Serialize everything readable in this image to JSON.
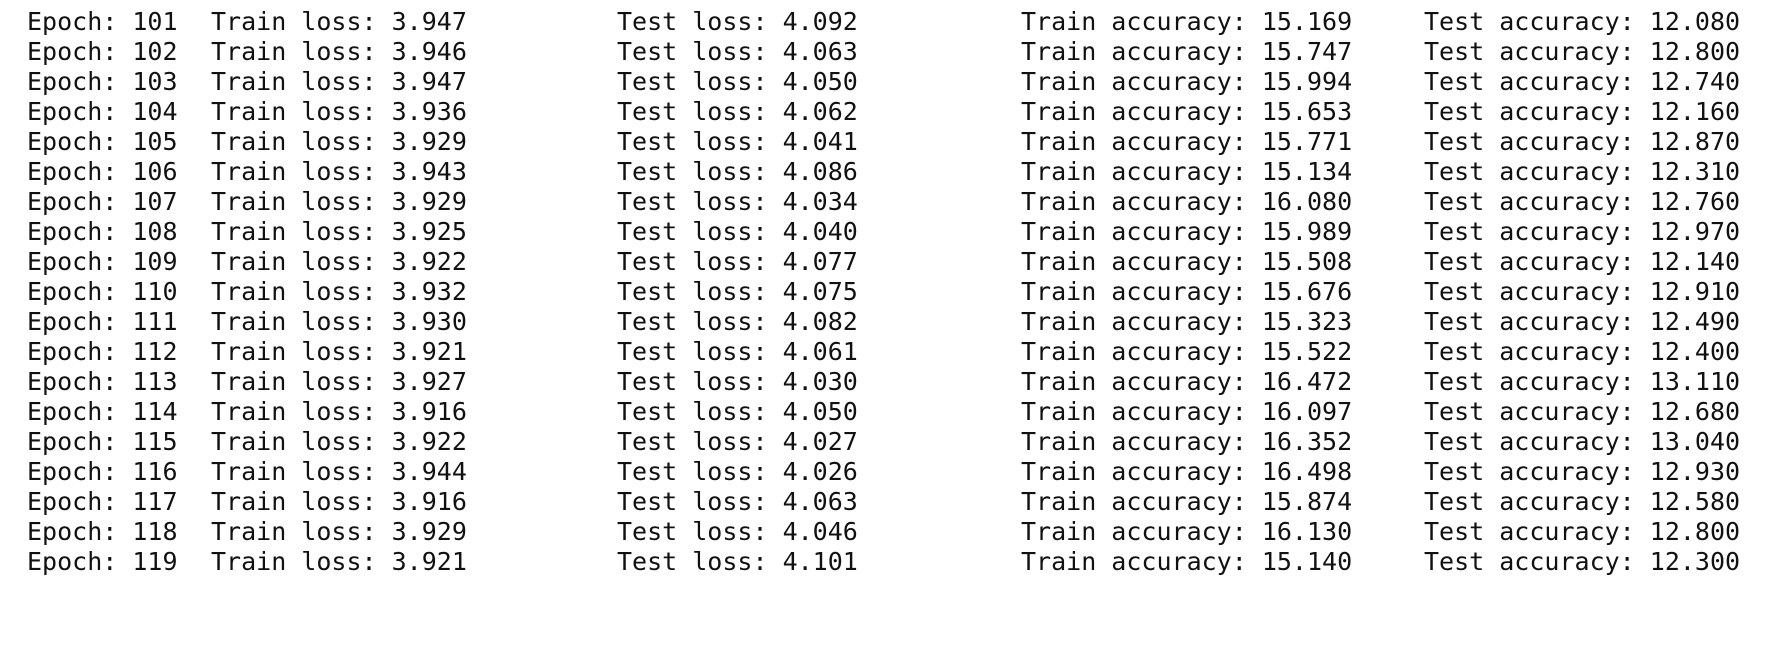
{
  "log": {
    "rows": [
      {
        "epoch": "Epoch: 101",
        "train_loss": "Train loss: 3.947",
        "test_loss": "Test loss: 4.092",
        "train_acc": "Train accuracy: 15.169",
        "test_acc": "Test accuracy: 12.080"
      },
      {
        "epoch": "Epoch: 102",
        "train_loss": "Train loss: 3.946",
        "test_loss": "Test loss: 4.063",
        "train_acc": "Train accuracy: 15.747",
        "test_acc": "Test accuracy: 12.800"
      },
      {
        "epoch": "Epoch: 103",
        "train_loss": "Train loss: 3.947",
        "test_loss": "Test loss: 4.050",
        "train_acc": "Train accuracy: 15.994",
        "test_acc": "Test accuracy: 12.740"
      },
      {
        "epoch": "Epoch: 104",
        "train_loss": "Train loss: 3.936",
        "test_loss": "Test loss: 4.062",
        "train_acc": "Train accuracy: 15.653",
        "test_acc": "Test accuracy: 12.160"
      },
      {
        "epoch": "Epoch: 105",
        "train_loss": "Train loss: 3.929",
        "test_loss": "Test loss: 4.041",
        "train_acc": "Train accuracy: 15.771",
        "test_acc": "Test accuracy: 12.870"
      },
      {
        "epoch": "Epoch: 106",
        "train_loss": "Train loss: 3.943",
        "test_loss": "Test loss: 4.086",
        "train_acc": "Train accuracy: 15.134",
        "test_acc": "Test accuracy: 12.310"
      },
      {
        "epoch": "Epoch: 107",
        "train_loss": "Train loss: 3.929",
        "test_loss": "Test loss: 4.034",
        "train_acc": "Train accuracy: 16.080",
        "test_acc": "Test accuracy: 12.760"
      },
      {
        "epoch": "Epoch: 108",
        "train_loss": "Train loss: 3.925",
        "test_loss": "Test loss: 4.040",
        "train_acc": "Train accuracy: 15.989",
        "test_acc": "Test accuracy: 12.970"
      },
      {
        "epoch": "Epoch: 109",
        "train_loss": "Train loss: 3.922",
        "test_loss": "Test loss: 4.077",
        "train_acc": "Train accuracy: 15.508",
        "test_acc": "Test accuracy: 12.140"
      },
      {
        "epoch": "Epoch: 110",
        "train_loss": "Train loss: 3.932",
        "test_loss": "Test loss: 4.075",
        "train_acc": "Train accuracy: 15.676",
        "test_acc": "Test accuracy: 12.910"
      },
      {
        "epoch": "Epoch: 111",
        "train_loss": "Train loss: 3.930",
        "test_loss": "Test loss: 4.082",
        "train_acc": "Train accuracy: 15.323",
        "test_acc": "Test accuracy: 12.490"
      },
      {
        "epoch": "Epoch: 112",
        "train_loss": "Train loss: 3.921",
        "test_loss": "Test loss: 4.061",
        "train_acc": "Train accuracy: 15.522",
        "test_acc": "Test accuracy: 12.400"
      },
      {
        "epoch": "Epoch: 113",
        "train_loss": "Train loss: 3.927",
        "test_loss": "Test loss: 4.030",
        "train_acc": "Train accuracy: 16.472",
        "test_acc": "Test accuracy: 13.110"
      },
      {
        "epoch": "Epoch: 114",
        "train_loss": "Train loss: 3.916",
        "test_loss": "Test loss: 4.050",
        "train_acc": "Train accuracy: 16.097",
        "test_acc": "Test accuracy: 12.680"
      },
      {
        "epoch": "Epoch: 115",
        "train_loss": "Train loss: 3.922",
        "test_loss": "Test loss: 4.027",
        "train_acc": "Train accuracy: 16.352",
        "test_acc": "Test accuracy: 13.040"
      },
      {
        "epoch": "Epoch: 116",
        "train_loss": "Train loss: 3.944",
        "test_loss": "Test loss: 4.026",
        "train_acc": "Train accuracy: 16.498",
        "test_acc": "Test accuracy: 12.930"
      },
      {
        "epoch": "Epoch: 117",
        "train_loss": "Train loss: 3.916",
        "test_loss": "Test loss: 4.063",
        "train_acc": "Train accuracy: 15.874",
        "test_acc": "Test accuracy: 12.580"
      },
      {
        "epoch": "Epoch: 118",
        "train_loss": "Train loss: 3.929",
        "test_loss": "Test loss: 4.046",
        "train_acc": "Train accuracy: 16.130",
        "test_acc": "Test accuracy: 12.800"
      },
      {
        "epoch": "Epoch: 119",
        "train_loss": "Train loss: 3.921",
        "test_loss": "Test loss: 4.101",
        "train_acc": "Train accuracy: 15.140",
        "test_acc": "Test accuracy: 12.300"
      }
    ]
  }
}
